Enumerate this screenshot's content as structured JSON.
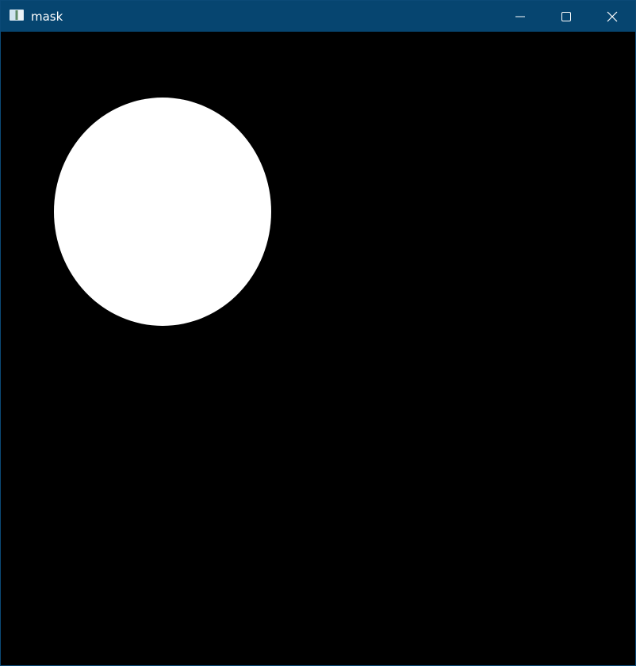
{
  "window": {
    "title": "mask",
    "icon": "app-image-window-icon",
    "controls": {
      "minimize_icon": "minimize-icon",
      "maximize_icon": "maximize-icon",
      "close_icon": "close-icon"
    }
  },
  "canvas": {
    "background_color": "#000000",
    "shape": "ellipse",
    "shape_color": "#ffffff"
  }
}
